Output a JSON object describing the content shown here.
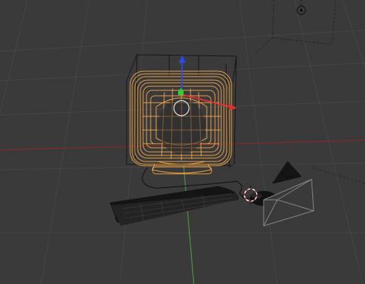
{
  "app": {
    "name": "3D viewport",
    "view": "perspective",
    "shading": "wireframe"
  },
  "colors": {
    "background": "#3a3a3a",
    "grid_line": "#474747",
    "x_axis": "#8a2a2a",
    "y_axis": "#4f9a3a",
    "selected_wire": "#f2a446",
    "unselected_wire": "#141414",
    "gizmo_x": "#e03030",
    "gizmo_y": "#38c838",
    "gizmo_z": "#2f49e0",
    "gizmo_center": "#d8d8d8",
    "camera_outline": "#8a8a8a",
    "3d_cursor_ring": "#e04040"
  },
  "objects": [
    {
      "name": "monitor",
      "selected": true,
      "active": true
    },
    {
      "name": "keyboard",
      "selected": false
    },
    {
      "name": "mouse",
      "selected": false
    },
    {
      "name": "cable",
      "selected": false
    },
    {
      "name": "camera",
      "selected": false
    },
    {
      "name": "lamp",
      "selected": false
    }
  ],
  "gizmo": {
    "mode": "translate",
    "axes": [
      "x",
      "y",
      "z"
    ]
  },
  "cursor_3d": {
    "visible": true
  }
}
